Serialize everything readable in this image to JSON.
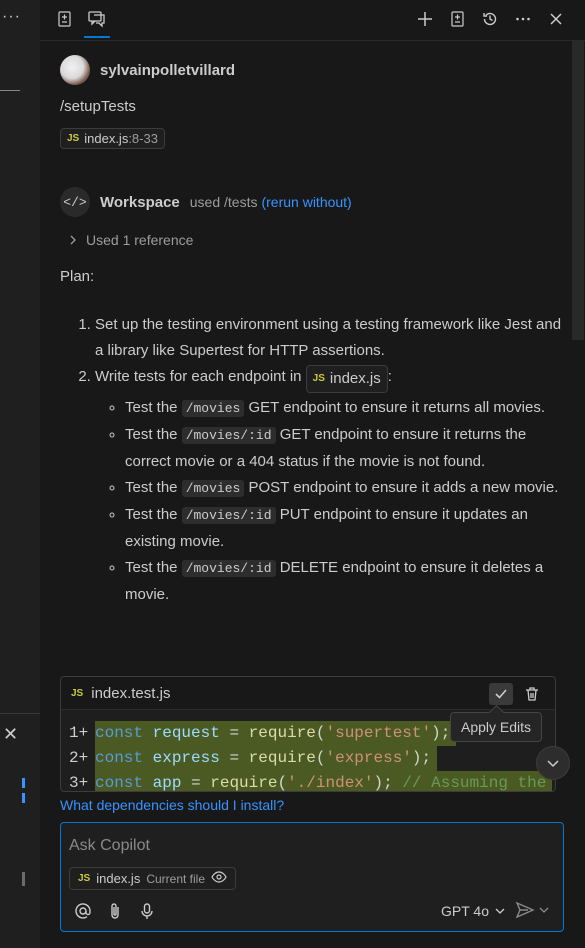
{
  "left_strip": {
    "more_glyph": "···",
    "close_glyph": "✕"
  },
  "toolbar": {
    "icons": [
      "chat-edits-icon",
      "chat-icon",
      "new-chat-icon",
      "export-icon",
      "history-icon",
      "more-icon",
      "close-icon"
    ]
  },
  "user": {
    "name": "sylvainpolletvillard",
    "command": "/setupTests",
    "ref_file": "index.js",
    "ref_range": ":8-33"
  },
  "workspace": {
    "name": "Workspace",
    "used": "used /tests",
    "rerun": "(rerun without)",
    "references": "Used 1 reference"
  },
  "plan": {
    "heading": "Plan:",
    "step1": "Set up the testing environment using a testing framework like Jest and a library like Supertest for HTTP assertions.",
    "step2_pre": "Write tests for each endpoint in",
    "step2_file": "index.js",
    "step2_post": ":",
    "tests": [
      {
        "pre": "Test the",
        "code": "/movies",
        "post": "GET endpoint to ensure it returns all movies."
      },
      {
        "pre": "Test the",
        "code": "/movies/:id",
        "post": "GET endpoint to ensure it returns the correct movie or a 404 status if the movie is not found."
      },
      {
        "pre": "Test the",
        "code": "/movies",
        "post": "POST endpoint to ensure it adds a new movie."
      },
      {
        "pre": "Test the",
        "code": "/movies/:id",
        "post": "PUT endpoint to ensure it updates an existing movie."
      },
      {
        "pre": "Test the",
        "code": "/movies/:id",
        "post": "DELETE endpoint to ensure it deletes a movie."
      }
    ]
  },
  "codeblock": {
    "filename": "index.test.js",
    "tooltip": "Apply Edits",
    "lines": [
      {
        "n": "1",
        "mark": "+"
      },
      {
        "n": "2",
        "mark": "+"
      },
      {
        "n": "3",
        "mark": "+"
      }
    ],
    "tokens": {
      "l1": {
        "kw": "const",
        "var": "request",
        "op": " = ",
        "fn": "require",
        "str": "'supertest'",
        "end": ");"
      },
      "l2": {
        "kw": "const",
        "var": "express",
        "op": " = ",
        "fn": "require",
        "str": "'express'",
        "end": ");"
      },
      "l3": {
        "kw": "const",
        "var": "app",
        "op": " = ",
        "fn": "require",
        "str": "'./index'",
        "end": "); ",
        "cmt": "// Assuming the"
      }
    }
  },
  "suggestion": "What dependencies should I install?",
  "input": {
    "placeholder": "Ask Copilot",
    "ctx_file": "index.js",
    "ctx_sub": "Current file",
    "model": "GPT 4o"
  },
  "colors": {
    "accent": "#0078d4",
    "link": "#3794ff",
    "added_line": "#4b5a23"
  }
}
